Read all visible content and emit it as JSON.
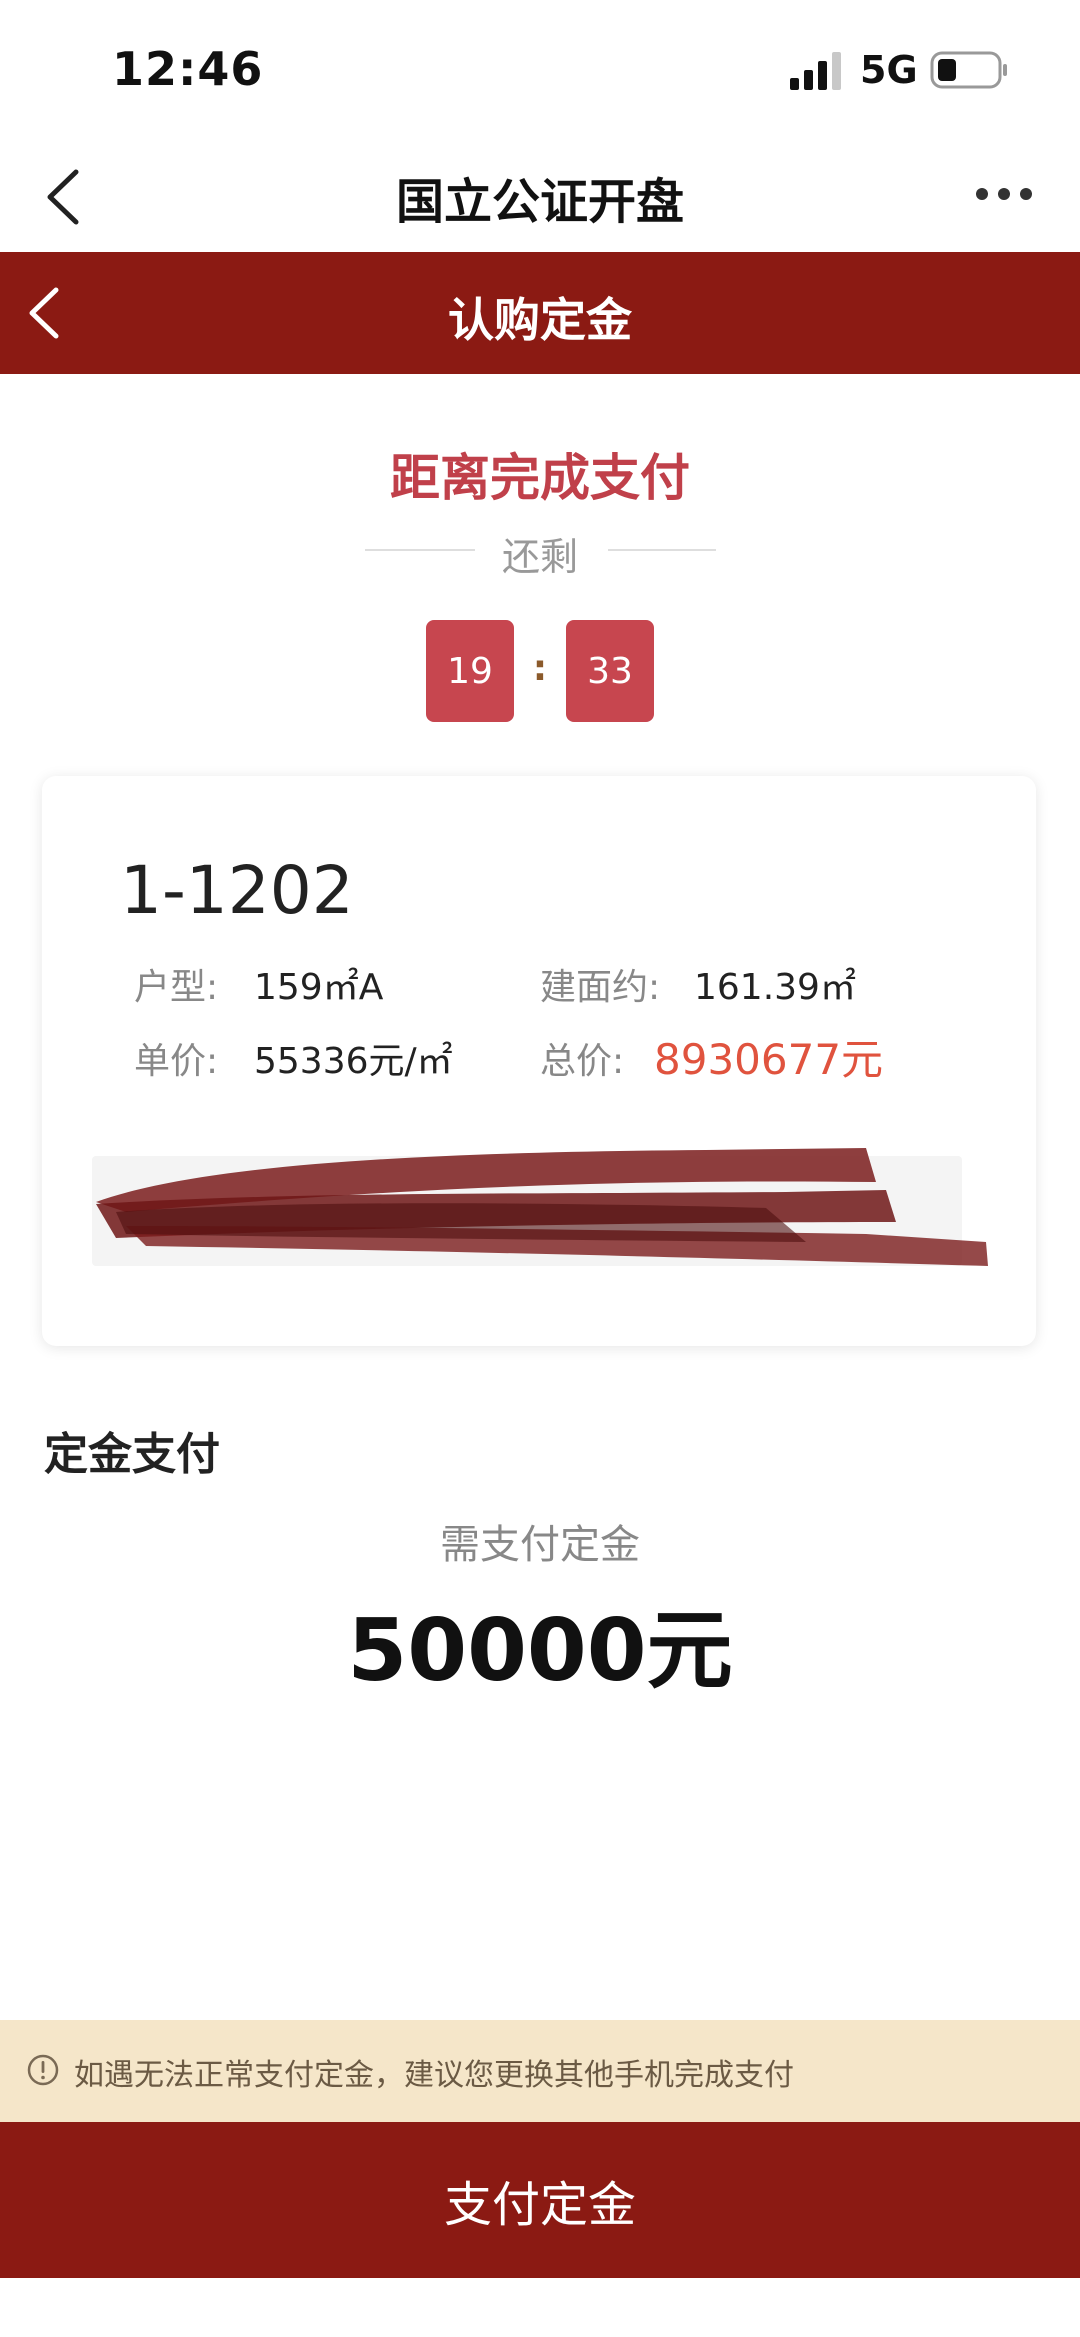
{
  "status_bar": {
    "time": "12:46",
    "network": "5G"
  },
  "header": {
    "title": "国立公证开盘"
  },
  "sub_header": {
    "title": "认购定金"
  },
  "countdown": {
    "title": "距离完成支付",
    "remain_label": "还剩",
    "minutes": "19",
    "separator": ":",
    "seconds": "33"
  },
  "unit": {
    "number": "1-1202",
    "layout_label": "户型:",
    "layout_value": "159㎡A",
    "area_label": "建面约:",
    "area_value": "161.39㎡",
    "unit_price_label": "单价:",
    "unit_price_value": "55336元/㎡",
    "total_price_label": "总价:",
    "total_price_value": "8930677元"
  },
  "deposit": {
    "section_title": "定金支付",
    "label": "需支付定金",
    "amount": "50000元"
  },
  "notice": {
    "text": "如遇无法正常支付定金，建议您更换其他手机完成支付"
  },
  "pay_button": {
    "label": "支付定金"
  },
  "colors": {
    "brand_red": "#8b1a13",
    "timer_red": "#c7464f",
    "price_red": "#e0533e",
    "notice_bg": "#f5e6c9"
  }
}
